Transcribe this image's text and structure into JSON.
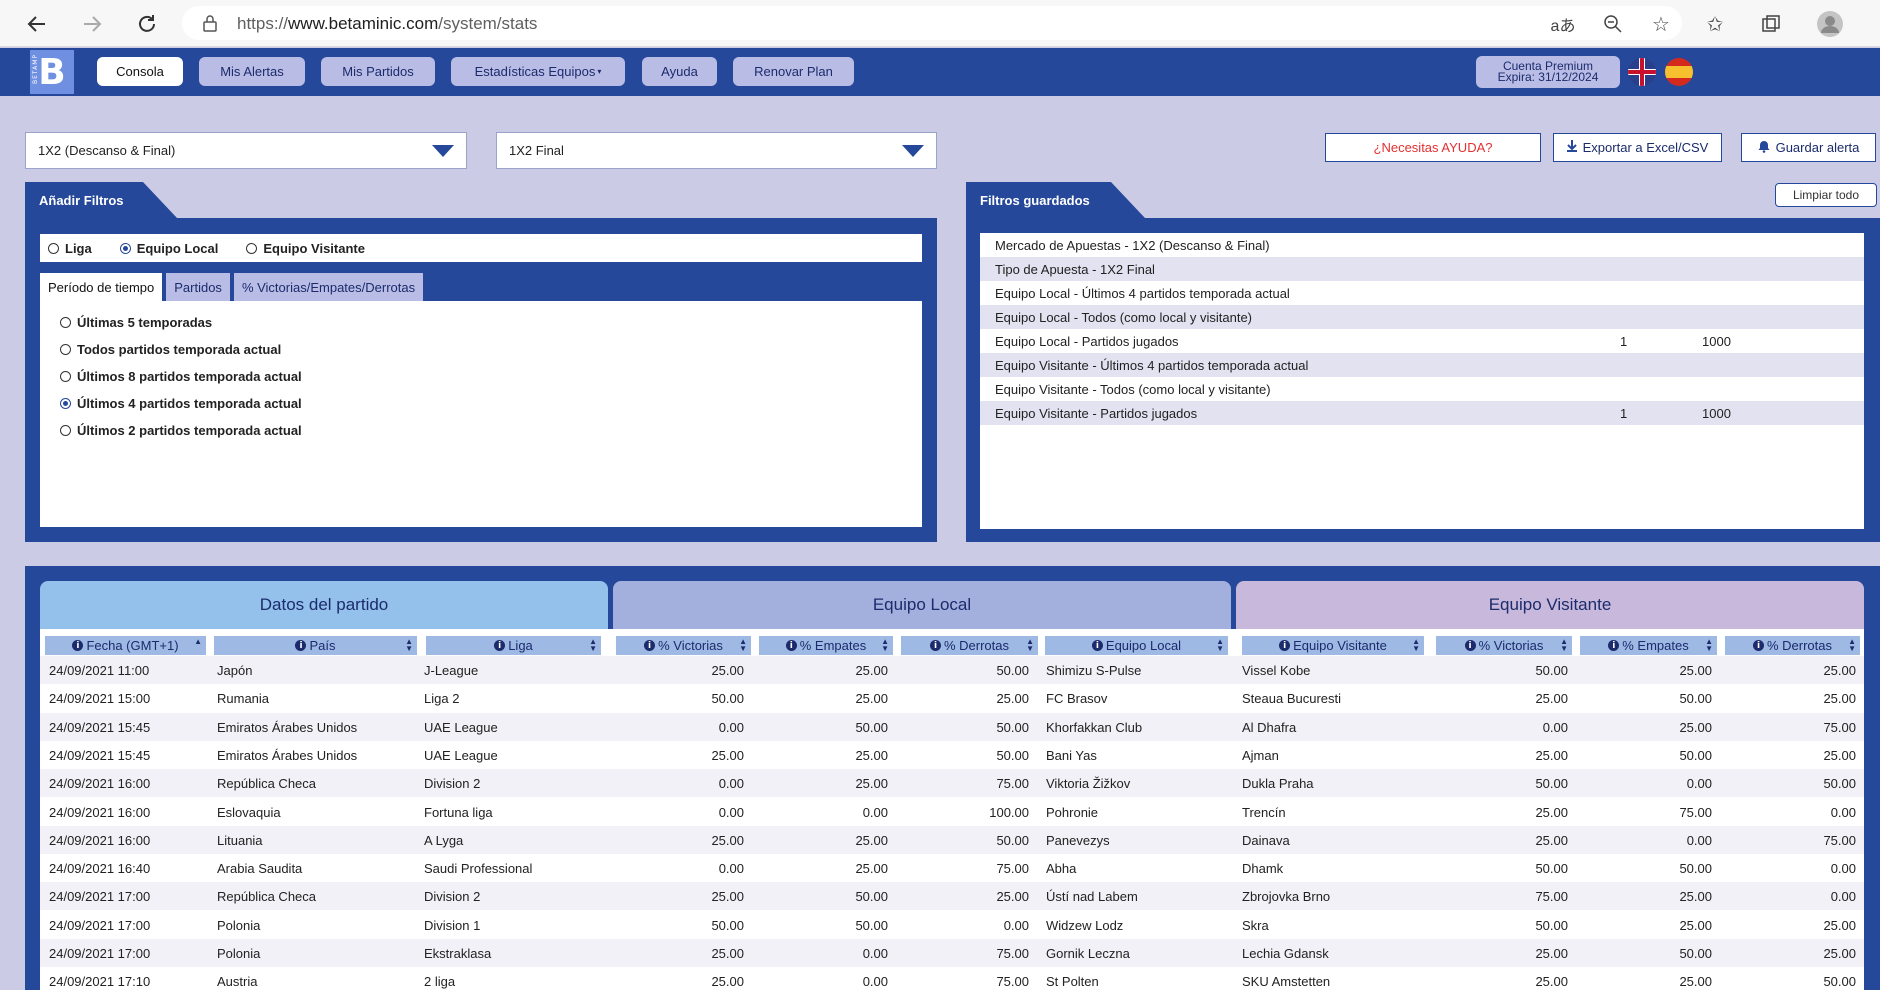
{
  "browser": {
    "url_prefix": "https://",
    "url_host": "www.betaminic.com",
    "url_path": "/system/stats"
  },
  "nav": {
    "logo_letter": "B",
    "logo_text": "BETAMP",
    "items": [
      "Consola",
      "Mis Alertas",
      "Mis Partidos",
      "Estadísticas Equipos",
      "Ayuda",
      "Renovar Plan"
    ],
    "premium_line1": "Cuenta Premium",
    "premium_line2": "Expira: 31/12/2024"
  },
  "selects": {
    "market": "1X2 (Descanso & Final)",
    "bet_type": "1X2 Final"
  },
  "actions": {
    "help": "¿Necesitas AYUDA?",
    "export": "Exportar a Excel/CSV",
    "save_alert": "Guardar alerta",
    "clear_all": "Limpiar todo"
  },
  "filters": {
    "title": "Añadir Filtros",
    "scope": [
      "Liga",
      "Equipo Local",
      "Equipo Visitante"
    ],
    "scope_selected": "Equipo Local",
    "subtabs": [
      "Período de tiempo",
      "Partidos",
      "% Victorias/Empates/Derrotas"
    ],
    "period_options": [
      "Últimas 5 temporadas",
      "Todos partidos temporada actual",
      "Últimos 8 partidos temporada actual",
      "Últimos 4 partidos temporada actual",
      "Últimos 2 partidos temporada actual"
    ],
    "period_selected": "Últimos 4 partidos temporada actual"
  },
  "saved": {
    "title": "Filtros guardados",
    "rows": [
      {
        "label": "Mercado de Apuestas - 1X2 (Descanso & Final)",
        "v1": "",
        "v2": ""
      },
      {
        "label": "Tipo de Apuesta - 1X2 Final",
        "v1": "",
        "v2": ""
      },
      {
        "label": "Equipo Local - Últimos 4 partidos temporada actual",
        "v1": "",
        "v2": ""
      },
      {
        "label": "Equipo Local - Todos (como local y visitante)",
        "v1": "",
        "v2": ""
      },
      {
        "label": "Equipo Local - Partidos jugados",
        "v1": "1",
        "v2": "1000"
      },
      {
        "label": "Equipo Visitante - Últimos 4 partidos temporada actual",
        "v1": "",
        "v2": ""
      },
      {
        "label": "Equipo Visitante - Todos (como local y visitante)",
        "v1": "",
        "v2": ""
      },
      {
        "label": "Equipo Visitante - Partidos jugados",
        "v1": "1",
        "v2": "1000"
      }
    ]
  },
  "table": {
    "groups": [
      "Datos del partido",
      "Equipo Local",
      "Equipo Visitante"
    ],
    "columns": [
      "Fecha (GMT+1)",
      "País",
      "Liga",
      "% Victorias",
      "% Empates",
      "% Derrotas",
      "Equipo Local",
      "Equipo Visitante",
      "% Victorias",
      "% Empates",
      "% Derrotas"
    ],
    "rows": [
      [
        "24/09/2021 11:00",
        "Japón",
        "J-League",
        "25.00",
        "25.00",
        "50.00",
        "Shimizu S-Pulse",
        "Vissel Kobe",
        "50.00",
        "25.00",
        "25.00"
      ],
      [
        "24/09/2021 15:00",
        "Rumania",
        "Liga 2",
        "50.00",
        "25.00",
        "25.00",
        "FC Brasov",
        "Steaua Bucuresti",
        "25.00",
        "50.00",
        "25.00"
      ],
      [
        "24/09/2021 15:45",
        "Emiratos Árabes Unidos",
        "UAE League",
        "0.00",
        "50.00",
        "50.00",
        "Khorfakkan Club",
        "Al Dhafra",
        "0.00",
        "25.00",
        "75.00"
      ],
      [
        "24/09/2021 15:45",
        "Emiratos Árabes Unidos",
        "UAE League",
        "25.00",
        "25.00",
        "50.00",
        "Bani Yas",
        "Ajman",
        "25.00",
        "50.00",
        "25.00"
      ],
      [
        "24/09/2021 16:00",
        "República Checa",
        "Division 2",
        "0.00",
        "25.00",
        "75.00",
        "Viktoria Žižkov",
        "Dukla Praha",
        "50.00",
        "0.00",
        "50.00"
      ],
      [
        "24/09/2021 16:00",
        "Eslovaquia",
        "Fortuna liga",
        "0.00",
        "0.00",
        "100.00",
        "Pohronie",
        "Trencín",
        "25.00",
        "75.00",
        "0.00"
      ],
      [
        "24/09/2021 16:00",
        "Lituania",
        "A Lyga",
        "25.00",
        "25.00",
        "50.00",
        "Panevezys",
        "Dainava",
        "25.00",
        "0.00",
        "75.00"
      ],
      [
        "24/09/2021 16:40",
        "Arabia Saudita",
        "Saudi Professional",
        "0.00",
        "25.00",
        "75.00",
        "Abha",
        "Dhamk",
        "50.00",
        "50.00",
        "0.00"
      ],
      [
        "24/09/2021 17:00",
        "República Checa",
        "Division 2",
        "25.00",
        "50.00",
        "25.00",
        "Ústí nad Labem",
        "Zbrojovka Brno",
        "75.00",
        "25.00",
        "0.00"
      ],
      [
        "24/09/2021 17:00",
        "Polonia",
        "Division 1",
        "50.00",
        "50.00",
        "0.00",
        "Widzew Lodz",
        "Skra",
        "50.00",
        "25.00",
        "25.00"
      ],
      [
        "24/09/2021 17:00",
        "Polonia",
        "Ekstraklasa",
        "25.00",
        "0.00",
        "75.00",
        "Gornik Leczna",
        "Lechia Gdansk",
        "25.00",
        "50.00",
        "25.00"
      ],
      [
        "24/09/2021 17:10",
        "Austria",
        "2 liga",
        "25.00",
        "0.00",
        "75.00",
        "St Polten",
        "SKU Amstetten",
        "25.00",
        "25.00",
        "50.00"
      ]
    ]
  }
}
